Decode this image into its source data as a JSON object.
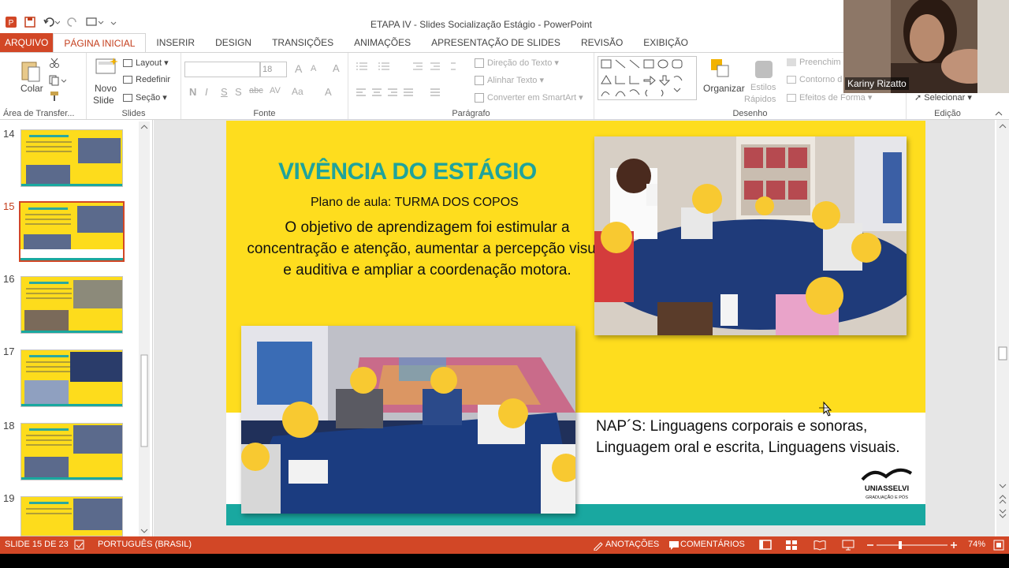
{
  "window": {
    "title": "ETAPA IV - Slides Socialização Estágio - PowerPoint"
  },
  "tabs": [
    "ARQUIVO",
    "PÁGINA INICIAL",
    "INSERIR",
    "DESIGN",
    "TRANSIÇÕES",
    "ANIMAÇÕES",
    "APRESENTAÇÃO DE SLIDES",
    "REVISÃO",
    "EXIBIÇÃO"
  ],
  "ribbon": {
    "clipboard": {
      "paste": "Colar",
      "group": "Área de Transfer..."
    },
    "slides": {
      "new_slide_1": "Novo",
      "new_slide_2": "Slide",
      "layout": "Layout",
      "reset": "Redefinir",
      "section": "Seção",
      "group": "Slides"
    },
    "font": {
      "size": "18",
      "bold": "N",
      "italic": "I",
      "underline": "S",
      "shadow": "S",
      "strike": "abc",
      "spacing": "AV",
      "case": "Aa",
      "color": "A",
      "grow": "A",
      "shrink": "A",
      "clear": "A",
      "group": "Fonte"
    },
    "paragraph": {
      "text_direction": "Direção do Texto",
      "align_text": "Alinhar Texto",
      "smartart": "Converter em SmartArt",
      "group": "Parágrafo"
    },
    "drawing": {
      "arrange": "Organizar",
      "quick_styles_1": "Estilos",
      "quick_styles_2": "Rápidos",
      "fill": "Preenchim",
      "outline": "Contorno d",
      "effects": "Efeitos de Forma",
      "group": "Desenho"
    },
    "editing": {
      "select": "Selecionar",
      "group": "Edição"
    }
  },
  "thumbnails": [
    {
      "number": "14",
      "selected": false
    },
    {
      "number": "15",
      "selected": true
    },
    {
      "number": "16",
      "selected": false
    },
    {
      "number": "17",
      "selected": false
    },
    {
      "number": "18",
      "selected": false
    },
    {
      "number": "19",
      "selected": false
    }
  ],
  "slide": {
    "title": "VIVÊNCIA DO ESTÁGIO",
    "subtitle": "Plano de aula: TURMA DOS COPOS",
    "body": "O objetivo de aprendizagem foi estimular a concentração e atenção, aumentar a percepção visual e auditiva e ampliar a coordenação motora.",
    "naps": "NAP´S: Linguagens corporais e sonoras, Linguagem oral e escrita, Linguagens visuais.",
    "logo_name": "UNIASSELVI",
    "logo_tag": "GRADUAÇÃO E PÓS"
  },
  "status": {
    "slide_counter": "SLIDE 15 DE 23",
    "language": "PORTUGUÊS (BRASIL)",
    "notes": "ANOTAÇÕES",
    "comments": "COMENTÁRIOS",
    "zoom": "74%"
  },
  "webcam": {
    "name": "Kariny Rizatto"
  },
  "colors": {
    "accent": "#d24726",
    "slide_yellow": "#fedd1e",
    "teal": "#19a8a0",
    "title_teal": "#1fa39b"
  }
}
